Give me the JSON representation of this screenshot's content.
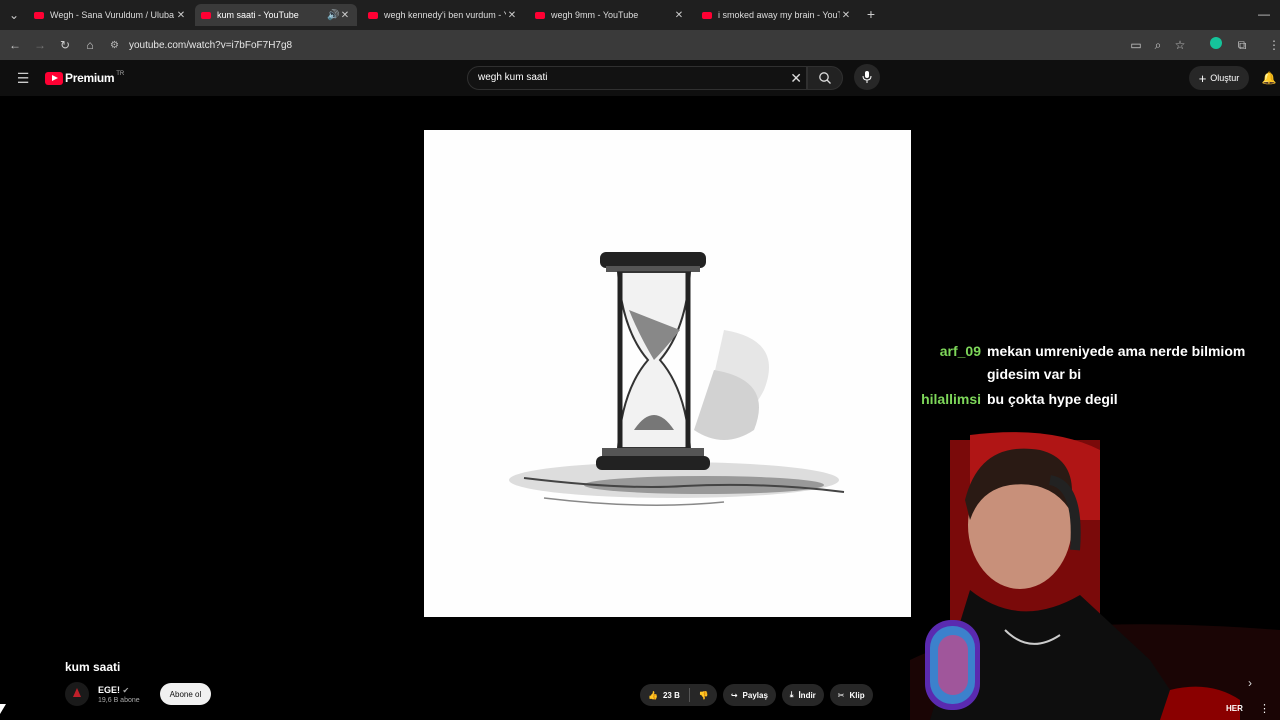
{
  "browser": {
    "tabs": [
      {
        "title": "Wegh - Sana Vuruldum / Uluba",
        "active": false
      },
      {
        "title": "kum saati - YouTube",
        "active": true
      },
      {
        "title": "wegh kennedy'i ben vurdum - Y",
        "active": false
      },
      {
        "title": "wegh 9mm - YouTube",
        "active": false
      },
      {
        "title": "i smoked away my brain - YouT",
        "active": false
      }
    ],
    "url": "youtube.com/watch?v=i7bFoF7H7g8"
  },
  "youtube": {
    "logo_text": "Premium",
    "region": "TR",
    "search_value": "wegh kum saati",
    "create_label": "Oluştur"
  },
  "video": {
    "title": "kum saati",
    "channel_name": "EGE!",
    "subscribers": "19,6 B abone",
    "subscribe_label": "Abone ol",
    "likes": "23 B",
    "share_label": "Paylaş",
    "download_label": "İndir",
    "clip_label": "Klip",
    "trailing_text": "HER"
  },
  "chat": [
    {
      "user": "arf_09",
      "message": "mekan umreniyede ama nerde bilmiom gidesim var bi"
    },
    {
      "user": "hilallimsi",
      "message": "bu çokta hype degil"
    }
  ],
  "colors": {
    "youtube_red": "#ff0033",
    "chat_user": "#7ed75a",
    "background": "#000000"
  }
}
